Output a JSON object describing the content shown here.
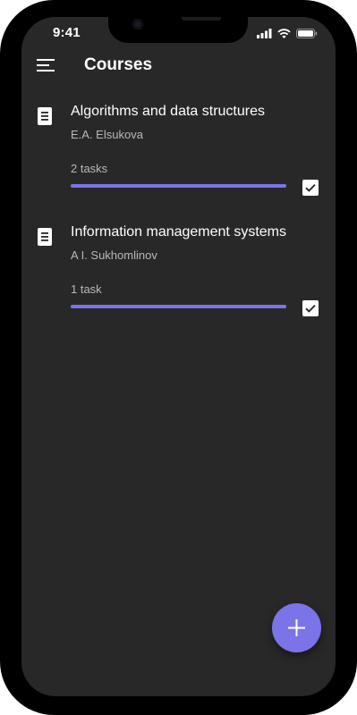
{
  "status_bar": {
    "time": "9:41",
    "icons": [
      "signal-icon",
      "wifi-icon",
      "battery-icon"
    ]
  },
  "app_bar": {
    "menu_icon": "menu-icon",
    "title": "Courses"
  },
  "courses": [
    {
      "icon": "document-icon",
      "title": "Algorithms and data structures",
      "author": "E.A. Elsukova",
      "tasks": "2 tasks",
      "progress": 1.0,
      "checked": true
    },
    {
      "icon": "document-icon",
      "title": "Information management systems",
      "author": "A I. Sukhomlinov",
      "tasks": "1 task",
      "progress": 1.0,
      "checked": true
    }
  ],
  "fab": {
    "icon": "plus-icon"
  },
  "colors": {
    "accent": "#7a74e8",
    "background": "#282829",
    "text_primary": "#ffffff",
    "text_secondary": "#b9b9bc"
  }
}
